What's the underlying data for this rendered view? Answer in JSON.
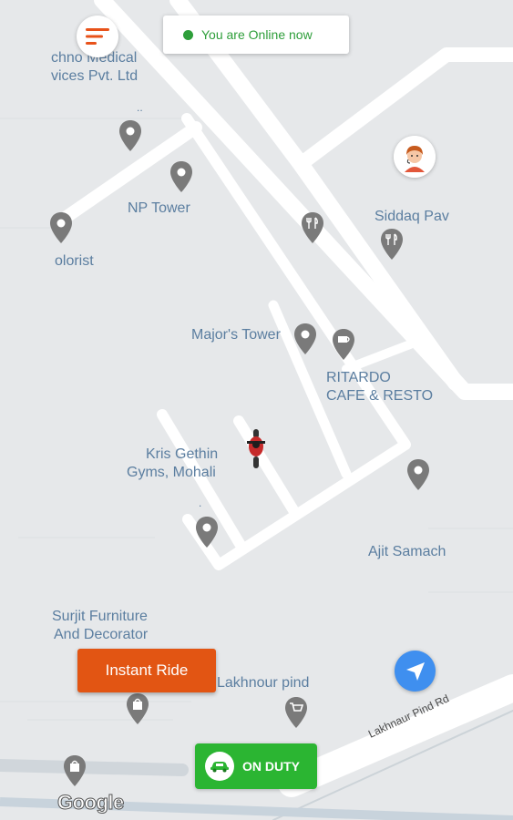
{
  "top_bar": {
    "menu_icon": "hamburger-menu-icon",
    "status_text": "You are Online now",
    "status_color": "#2e9e3a",
    "status_text_color": "#2e9e3a"
  },
  "map": {
    "labels": {
      "medical_line1": "chno Medical",
      "medical_line2": "vices Pvt. Ltd",
      "dots": "..",
      "np_tower": "NP Tower",
      "olorist": "olorist",
      "siddaq": "Siddaq Pav",
      "majors_tower": "Major's Tower",
      "ritardo_line1": "RITARDO",
      "ritardo_line2": "CAFE & RESTO",
      "kris_line1": "Kris Gethin",
      "kris_line2": "Gyms, Mohali",
      "dot": ".",
      "ajit": "Ajit Samach",
      "surjit_line1": "Surjit Furniture",
      "surjit_line2": "And Decorator",
      "lakhnour": "Lakhnour pind",
      "road_name": "Lakhnaur Pind Rd"
    },
    "pin_icon": "map-pin-icon",
    "restaurant_icon": "fork-knife-icon",
    "vehicle_icon": "motorbike-icon",
    "google_logo": "Google"
  },
  "avatar": {
    "icon": "driver-avatar-icon"
  },
  "actions": {
    "instant_ride_label": "Instant Ride",
    "instant_ride_color": "#e25513",
    "locate_icon": "navigation-arrow-icon",
    "locate_color": "#3f8fef",
    "duty_label": "ON DUTY",
    "duty_color": "#2bb532",
    "duty_icon": "car-icon"
  }
}
